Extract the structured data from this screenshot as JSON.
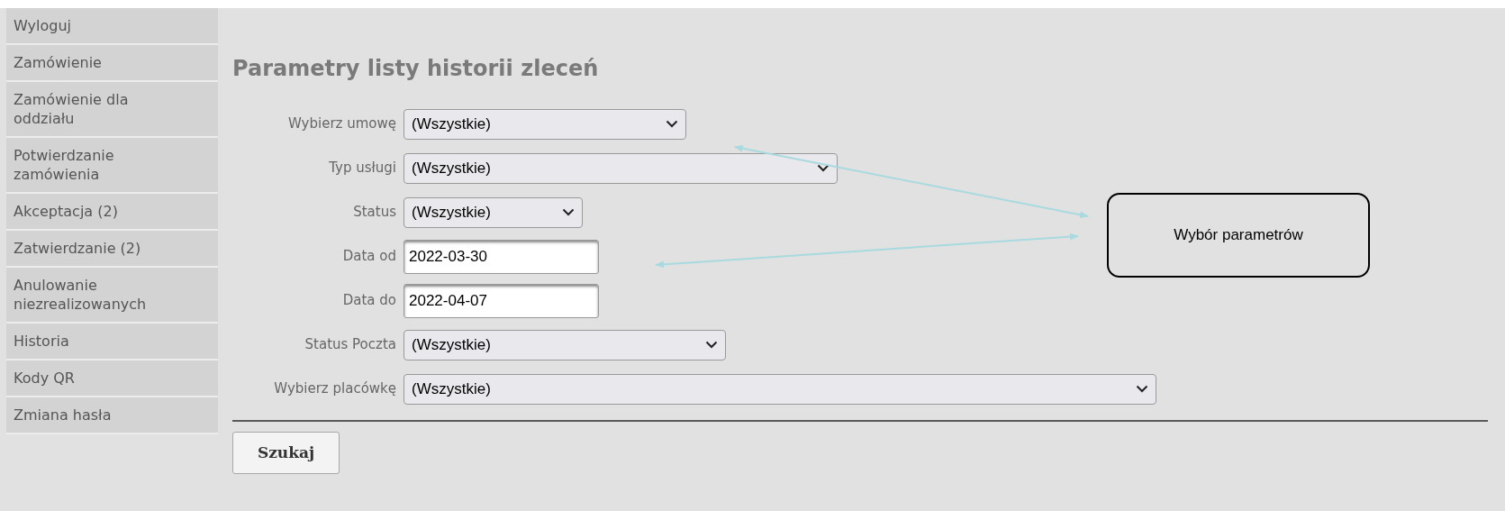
{
  "sidebar": {
    "items": [
      {
        "label": "Wyloguj"
      },
      {
        "label": "Zamówienie"
      },
      {
        "label": "Zamówienie dla oddziału"
      },
      {
        "label": "Potwierdzanie zamówienia"
      },
      {
        "label": "Akceptacja (2)"
      },
      {
        "label": "Zatwierdzanie (2)"
      },
      {
        "label": "Anulowanie niezrealizowanych"
      },
      {
        "label": "Historia"
      },
      {
        "label": "Kody QR"
      },
      {
        "label": "Zmiana hasła"
      }
    ]
  },
  "form": {
    "title": "Parametry listy historii zleceń",
    "fields": [
      {
        "kind": "select",
        "label": "Wybierz umowę",
        "value": "(Wszystkie)"
      },
      {
        "kind": "select",
        "label": "Typ usługi",
        "value": "(Wszystkie)"
      },
      {
        "kind": "select",
        "label": "Status",
        "value": "(Wszystkie)"
      },
      {
        "kind": "date",
        "label": "Data od",
        "value": "2022-03-30"
      },
      {
        "kind": "date",
        "label": "Data do",
        "value": "2022-04-07"
      },
      {
        "kind": "select",
        "label": "Status Poczta",
        "value": "(Wszystkie)"
      },
      {
        "kind": "select",
        "label": "Wybierz placówkę",
        "value": "(Wszystkie)"
      }
    ],
    "submit": "Szukaj"
  },
  "annotation": {
    "text": "Wybór parametrów"
  }
}
